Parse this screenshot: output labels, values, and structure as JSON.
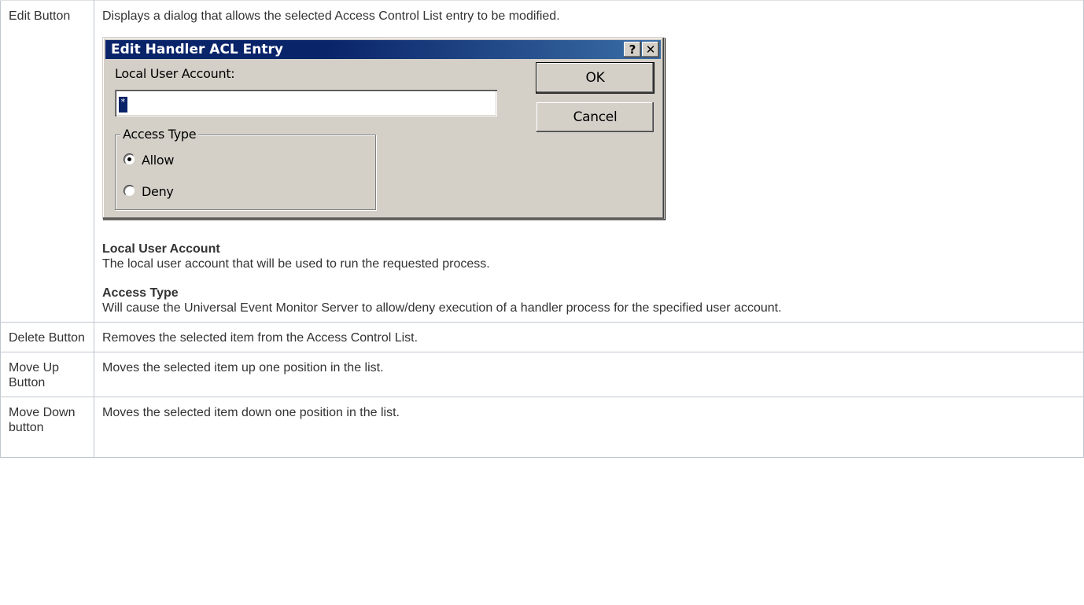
{
  "rows": [
    {
      "term": "Edit Button",
      "description": "Displays a dialog that allows the selected Access Control List entry to be modified.",
      "dialog": {
        "title": "Edit Handler ACL Entry",
        "help_label": "?",
        "close_label": "✕",
        "local_user_label": "Local User Account:",
        "local_user_value": "*",
        "ok_label": "OK",
        "cancel_label": "Cancel",
        "access_type_label": "Access Type",
        "allow_label": "Allow",
        "deny_label": "Deny",
        "selected": "Allow"
      },
      "sections": [
        {
          "heading": "Local User Account",
          "text": "The local user account that will be used to run the requested process."
        },
        {
          "heading": "Access Type",
          "text": "Will cause the Universal Event Monitor Server to allow/deny execution of a handler process for the specified user account."
        }
      ]
    },
    {
      "term": "Delete Button",
      "description": "Removes the selected item from the Access Control List."
    },
    {
      "term": "Move Up Button",
      "description": "Moves the selected item up one position in the list."
    },
    {
      "term": "Move Down button",
      "description": "Moves the selected item down one position in the list."
    }
  ]
}
